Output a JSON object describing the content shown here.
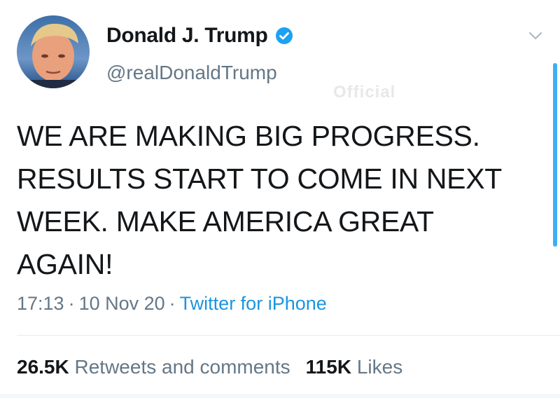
{
  "tweet": {
    "display_name": "Donald J. Trump",
    "handle": "@realDonaldTrump",
    "text": "WE ARE MAKING BIG PROGRESS. RESULTS START TO COME IN NEXT WEEK. MAKE AMERICA GREAT AGAIN!",
    "time": "17:13",
    "date": "10 Nov 20",
    "source": "Twitter for iPhone",
    "retweets_count": "26.5K",
    "retweets_label": "Retweets and comments",
    "likes_count": "115K",
    "likes_label": "Likes"
  },
  "watermark": "Official",
  "icons": {
    "verified": "verified-badge-icon",
    "menu": "chevron-down-icon"
  },
  "colors": {
    "link": "#1b95e0",
    "verified": "#1da1f2",
    "secondary_text": "#657786",
    "primary_text": "#14171a"
  }
}
